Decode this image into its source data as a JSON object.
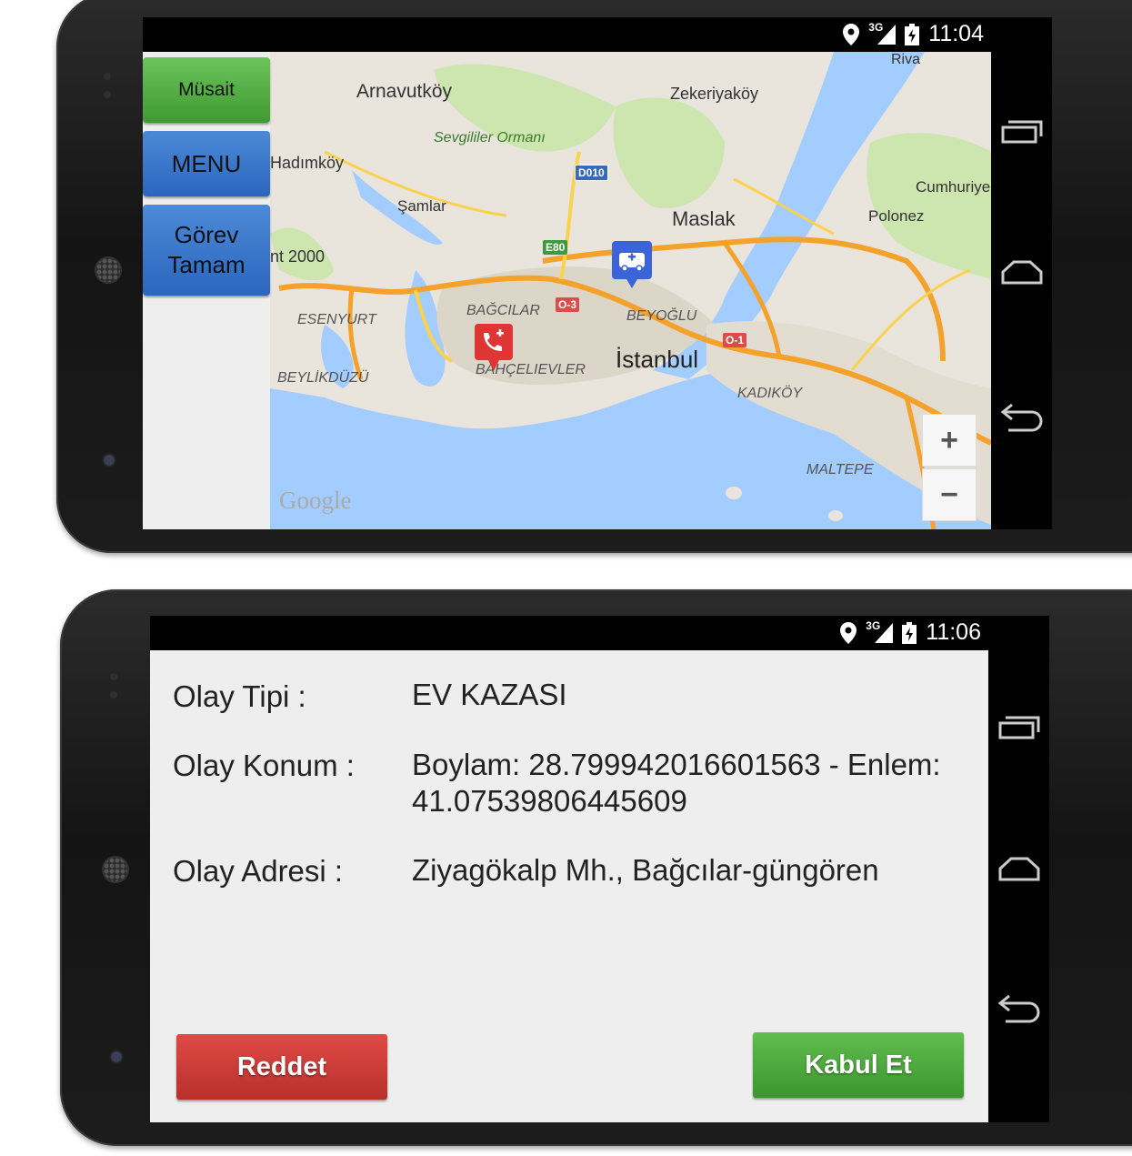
{
  "screen1": {
    "status": {
      "network": "3G",
      "time": "11:04"
    },
    "buttons": {
      "musait": "Müsait",
      "menu": "MENU",
      "gorev_line1": "Görev",
      "gorev_line2": "Tamam"
    },
    "map": {
      "places": [
        "Riva",
        "Arnavutköy",
        "Zekeriyaköy",
        "Sevgililer Ormanı",
        "Hadımköy",
        "Şamlar",
        "Maslak",
        "Cumhuriye",
        "Polonez",
        "nt 2000",
        "ESENYURT",
        "BAĞCILAR",
        "BEYOĞLU",
        "İstanbul",
        "BEYLİKDÜZÜ",
        "BAHÇELIEVLER",
        "KADIKÖY",
        "MALTEPE"
      ],
      "road_shields": [
        "D010",
        "E80",
        "O-3",
        "O-1"
      ],
      "zoom_in": "+",
      "zoom_out": "−",
      "attribution": "Google"
    }
  },
  "screen2": {
    "status": {
      "network": "3G",
      "time": "11:06"
    },
    "fields": [
      {
        "label": "Olay Tipi :",
        "value": "EV KAZASI"
      },
      {
        "label": "Olay Konum :",
        "value_line1": "Boylam: 28.799942016601563 - Enlem:",
        "value_line2": "41.07539806445609"
      },
      {
        "label": "Olay Adresi :",
        "value": "Ziyagökalp Mh., Bağcılar-güngören"
      }
    ],
    "buttons": {
      "reject": "Reddet",
      "accept": "Kabul Et"
    }
  },
  "colors": {
    "green": "#4caf3e",
    "blue": "#3777cc",
    "red": "#cc3a36",
    "water": "#a3ccff",
    "road": "#f4a22c"
  }
}
